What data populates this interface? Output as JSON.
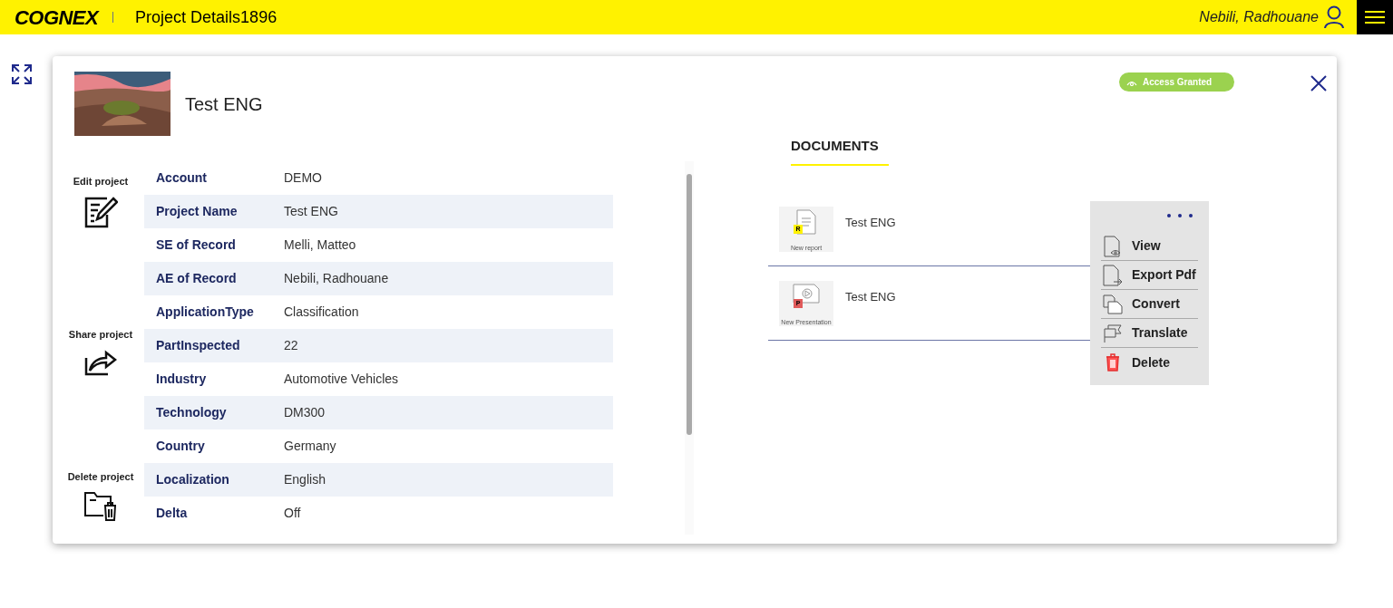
{
  "header": {
    "logo": "COGNEX",
    "title": "Project Details1896",
    "user": "Nebili, Radhouane"
  },
  "project": {
    "title": "Test ENG",
    "badge": "Access Granted"
  },
  "actions": [
    {
      "kind": "edit",
      "label": "Edit project"
    },
    {
      "kind": "share",
      "label": "Share project"
    },
    {
      "kind": "delete",
      "label": "Delete project"
    }
  ],
  "fields": [
    {
      "label": "Account",
      "value": "DEMO"
    },
    {
      "label": "Project Name",
      "value": "Test ENG"
    },
    {
      "label": "SE of Record",
      "value": "Melli, Matteo"
    },
    {
      "label": "AE of Record",
      "value": "Nebili, Radhouane"
    },
    {
      "label": "ApplicationType",
      "value": "Classification"
    },
    {
      "label": "PartInspected",
      "value": "22"
    },
    {
      "label": "Industry",
      "value": "Automotive Vehicles"
    },
    {
      "label": "Technology",
      "value": "DM300"
    },
    {
      "label": "Country",
      "value": "Germany"
    },
    {
      "label": "Localization",
      "value": "English"
    },
    {
      "label": "Delta",
      "value": "Off"
    }
  ],
  "tabs": [
    {
      "label": "DOCUMENTS",
      "selected": true
    }
  ],
  "documents": [
    {
      "kind": "report",
      "name": "Test ENG",
      "badge": "R",
      "caption": "New report"
    },
    {
      "kind": "presentation",
      "name": "Test ENG",
      "badge": "P",
      "caption": "New Presentation"
    }
  ],
  "menu": [
    {
      "kind": "view",
      "label": "View"
    },
    {
      "kind": "export",
      "label": "Export Pdf"
    },
    {
      "kind": "convert",
      "label": "Convert"
    },
    {
      "kind": "translate",
      "label": "Translate"
    },
    {
      "kind": "delete",
      "label": "Delete"
    }
  ]
}
